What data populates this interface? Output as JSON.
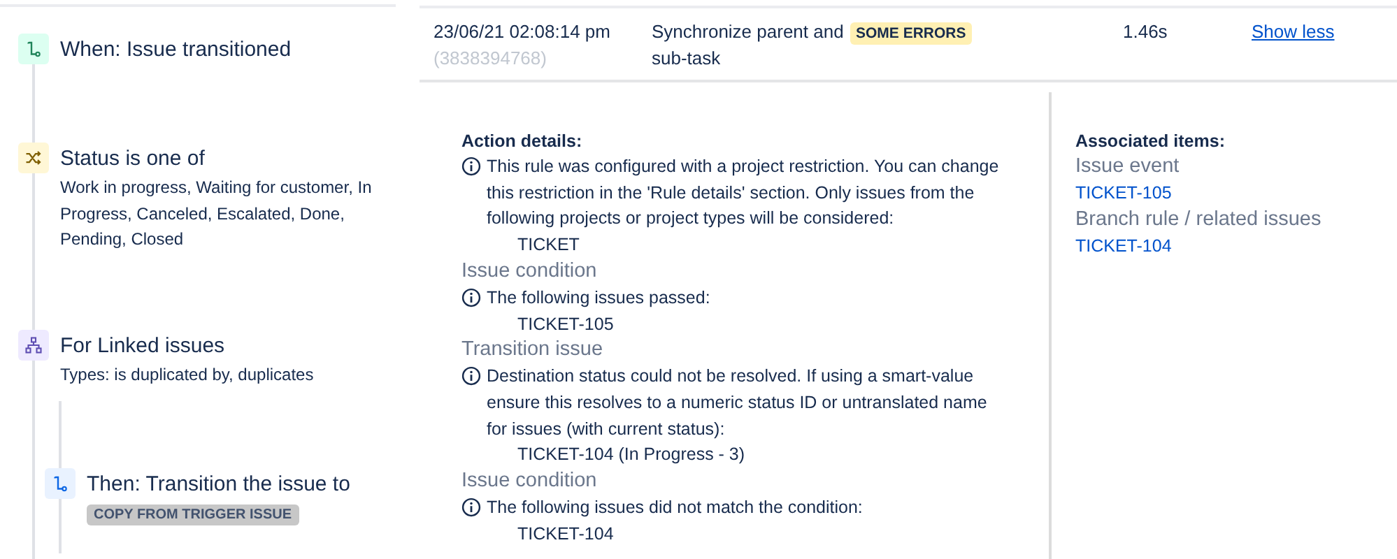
{
  "components": [
    {
      "kind": "trigger",
      "title": "When: Issue transitioned"
    },
    {
      "kind": "condition",
      "title": "Status is one of",
      "detail": "Work in progress, Waiting for customer, In Progress, Canceled, Escalated, Done, Pending, Closed"
    },
    {
      "kind": "branch",
      "title": "For Linked issues",
      "detail": "Types: is duplicated by, duplicates",
      "children": [
        {
          "kind": "action",
          "title": "Then: Transition the issue to",
          "tag": "COPY FROM TRIGGER ISSUE"
        }
      ]
    }
  ],
  "execution": {
    "date": "23/06/21 02:08:14 pm",
    "id": "(3838394768)",
    "rule": "Synchronize parent and sub-task",
    "status": {
      "label": "SOME ERRORS",
      "kind": "warning"
    },
    "duration": "1.46s",
    "toggle": "Show less"
  },
  "details": {
    "heading": "Action details:",
    "sections": [
      {
        "message": "This rule was configured with a project restriction. You can change this restriction in the 'Rule details' section. Only issues from the following projects or project types will be considered:",
        "items": [
          "TICKET"
        ]
      },
      {
        "title": "Issue condition",
        "message": "The following issues passed:",
        "items": [
          "TICKET-105"
        ]
      },
      {
        "title": "Transition issue",
        "message": "Destination status could not be resolved. If using a smart-value ensure this resolves to a numeric status ID or untranslated name for issues (with current status):",
        "items": [
          "TICKET-104 (In Progress - 3)"
        ]
      },
      {
        "title": "Issue condition",
        "message": "The following issues did not match the condition:",
        "items": [
          "TICKET-104"
        ]
      }
    ]
  },
  "associated": {
    "heading": "Associated items:",
    "groups": [
      {
        "label": "Issue event",
        "items": [
          "TICKET-105"
        ]
      },
      {
        "label": "Branch rule / related issues",
        "items": [
          "TICKET-104"
        ]
      }
    ]
  }
}
